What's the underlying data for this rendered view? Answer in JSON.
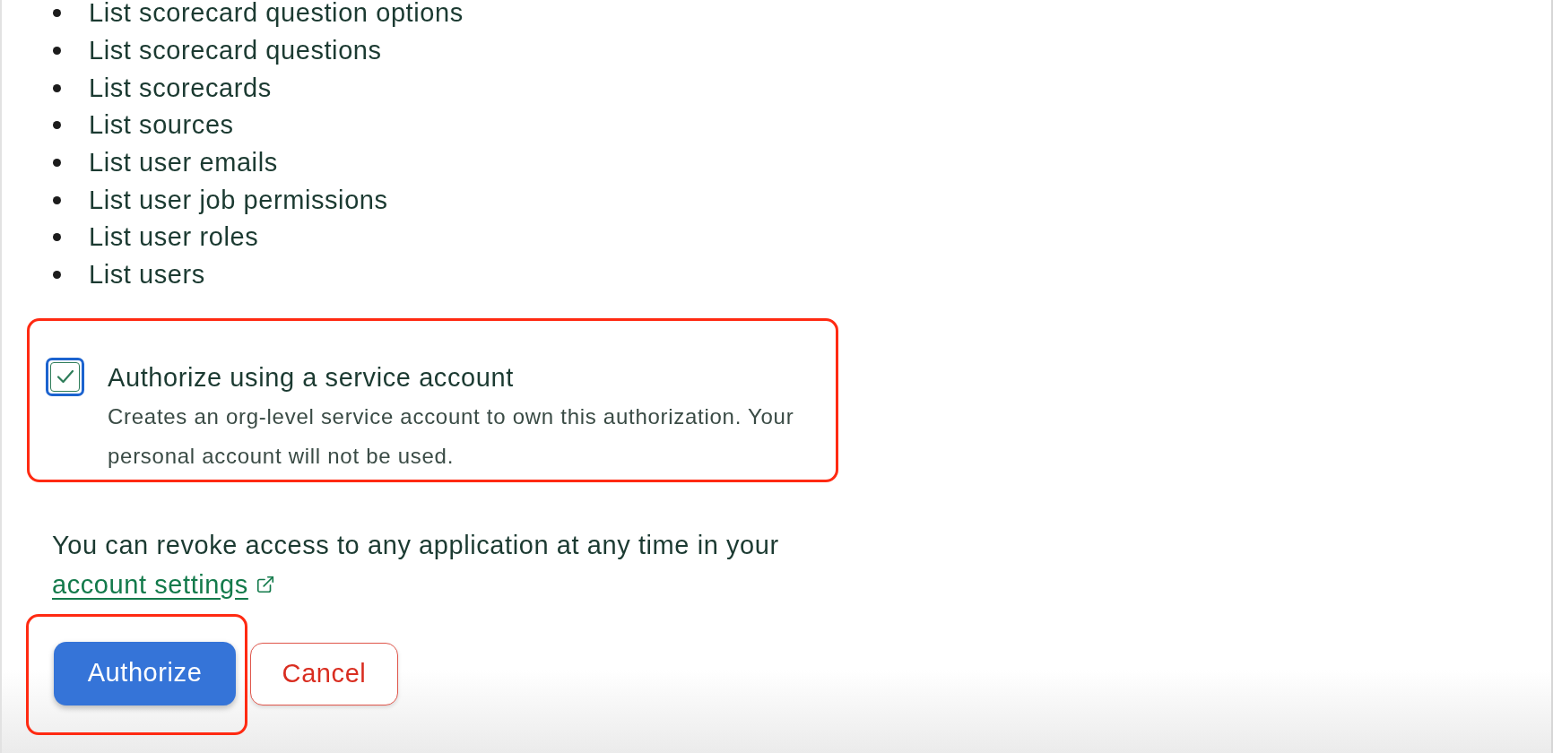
{
  "permissions": [
    "List scorecard question options",
    "List scorecard questions",
    "List scorecards",
    "List sources",
    "List user emails",
    "List user job permissions",
    "List user roles",
    "List users"
  ],
  "service_account": {
    "checked": true,
    "highlighted": true,
    "label": "Authorize using a service account",
    "description": "Creates an org-level service account to own this authorization. Your personal account will not be used."
  },
  "revoke_notice": {
    "text": "You can revoke access to any application at any time in your",
    "link": "account settings"
  },
  "buttons": [
    {
      "label": "Authorize",
      "kind": "primary",
      "highlighted": true
    },
    {
      "label": "Cancel",
      "kind": "danger",
      "highlighted": false
    }
  ]
}
